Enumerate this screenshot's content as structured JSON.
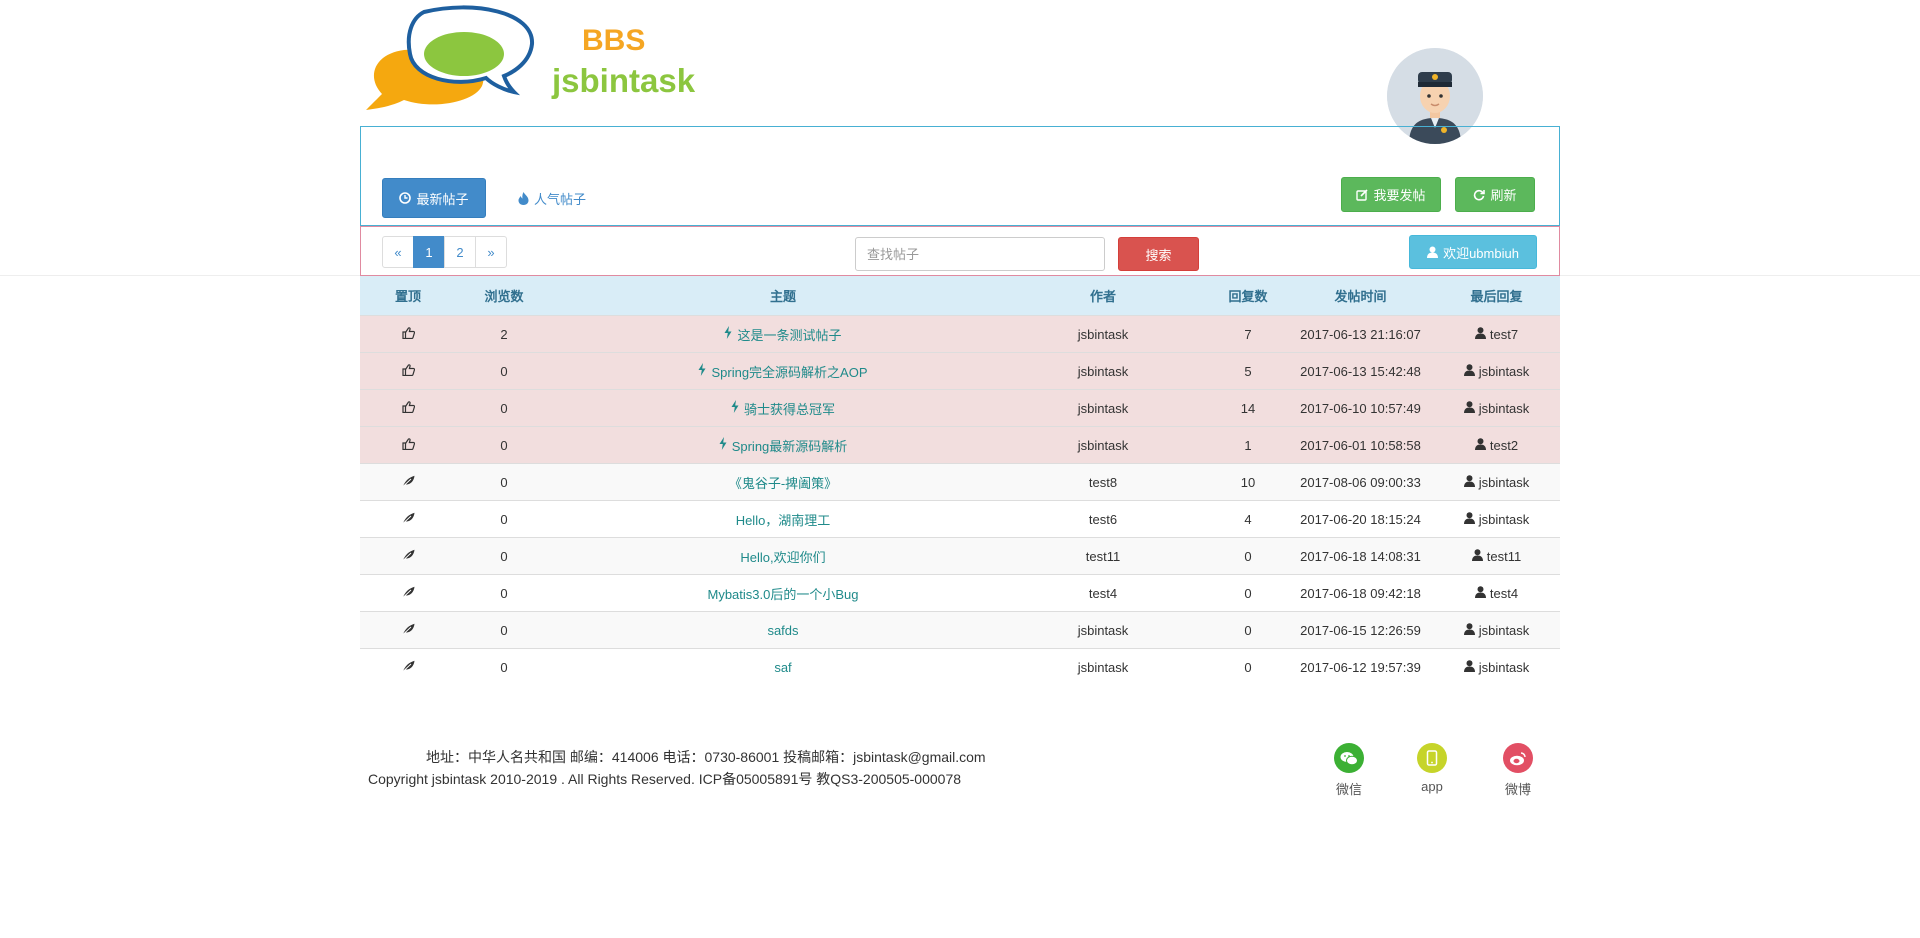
{
  "header": {
    "logo_bbs": "BBS",
    "logo_name": "jsbintask"
  },
  "nav": {
    "latest_tab": "最新帖子",
    "hot_tab": "人气帖子",
    "post_button": "我要发帖",
    "refresh_button": "刷新"
  },
  "toolbar": {
    "pagination": [
      "«",
      "1",
      "2",
      "»"
    ],
    "current_page": "1",
    "search_placeholder": "查找帖子",
    "search_button": "搜索",
    "welcome_button": "欢迎ubmbiuh"
  },
  "table": {
    "headers": [
      "置顶",
      "浏览数",
      "主题",
      "作者",
      "回复数",
      "发帖时间",
      "最后回复"
    ],
    "rows": [
      {
        "pinned": true,
        "views": "2",
        "title": "这是一条测试帖子",
        "author": "jsbintask",
        "replies": "7",
        "time": "2017-06-13 21:16:07",
        "last_reply": "test7"
      },
      {
        "pinned": true,
        "views": "0",
        "title": "Spring完全源码解析之AOP",
        "author": "jsbintask",
        "replies": "5",
        "time": "2017-06-13 15:42:48",
        "last_reply": "jsbintask"
      },
      {
        "pinned": true,
        "views": "0",
        "title": "骑士获得总冠军",
        "author": "jsbintask",
        "replies": "14",
        "time": "2017-06-10 10:57:49",
        "last_reply": "jsbintask"
      },
      {
        "pinned": true,
        "views": "0",
        "title": "Spring最新源码解析",
        "author": "jsbintask",
        "replies": "1",
        "time": "2017-06-01 10:58:58",
        "last_reply": "test2"
      },
      {
        "pinned": false,
        "views": "0",
        "title": "《鬼谷子-捭阖策》",
        "author": "test8",
        "replies": "10",
        "time": "2017-08-06 09:00:33",
        "last_reply": "jsbintask"
      },
      {
        "pinned": false,
        "views": "0",
        "title": "Hello，湖南理工",
        "author": "test6",
        "replies": "4",
        "time": "2017-06-20 18:15:24",
        "last_reply": "jsbintask"
      },
      {
        "pinned": false,
        "views": "0",
        "title": "Hello,欢迎你们",
        "author": "test11",
        "replies": "0",
        "time": "2017-06-18 14:08:31",
        "last_reply": "test11"
      },
      {
        "pinned": false,
        "views": "0",
        "title": "Mybatis3.0后的一个小Bug",
        "author": "test4",
        "replies": "0",
        "time": "2017-06-18 09:42:18",
        "last_reply": "test4"
      },
      {
        "pinned": false,
        "views": "0",
        "title": "safds",
        "author": "jsbintask",
        "replies": "0",
        "time": "2017-06-15 12:26:59",
        "last_reply": "jsbintask"
      },
      {
        "pinned": false,
        "views": "0",
        "title": "saf",
        "author": "jsbintask",
        "replies": "0",
        "time": "2017-06-12 19:57:39",
        "last_reply": "jsbintask"
      }
    ]
  },
  "footer": {
    "address": "地址：中华人名共和国 邮编：414006 电话：0730-86001 投稿邮箱：jsbintask@gmail.com",
    "copyright": "Copyright jsbintask 2010-2019 . All Rights Reserved. ICP备05005891号 教QS3-200505-000078",
    "social": [
      {
        "label": "微信",
        "icon": "wechat-icon",
        "color": "#3cb034"
      },
      {
        "label": "app",
        "icon": "mobile-icon",
        "color": "#c6d42a"
      },
      {
        "label": "微博",
        "icon": "weibo-icon",
        "color": "#e24f64"
      }
    ]
  },
  "colors": {
    "primary": "#428bca",
    "success": "#5cb85c",
    "danger": "#d9534f",
    "info": "#5bc0de",
    "pinned_row": "#f2dede",
    "header_row": "#d9edf7",
    "title_link": "#1f8a8a"
  }
}
